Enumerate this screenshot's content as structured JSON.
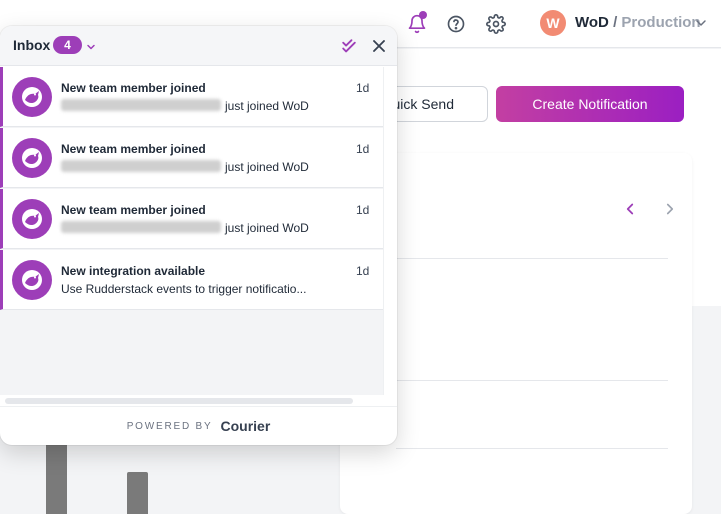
{
  "header": {
    "workspace": "WoD",
    "separator": "/",
    "environment": "Production",
    "avatar_initial": "W",
    "icons": [
      "bell-icon",
      "help-icon",
      "gear-icon",
      "chevron-down-icon"
    ]
  },
  "main": {
    "quick_send_label": "Quick Send",
    "quick_send_visible": "uick Send",
    "create_notification_label": "Create Notification"
  },
  "inbox": {
    "title": "Inbox",
    "count": "4",
    "items": [
      {
        "title": "New team member joined",
        "body": "just joined WoD",
        "body_redacted": true,
        "time": "1d"
      },
      {
        "title": "New team member joined",
        "body": "just joined WoD",
        "body_redacted": true,
        "time": "1d"
      },
      {
        "title": "New team member joined",
        "body": "just joined WoD",
        "body_redacted": true,
        "time": "1d"
      },
      {
        "title": "New integration available",
        "body": "Use Rudderstack events to trigger notificatio...",
        "body_redacted": false,
        "time": "1d"
      }
    ],
    "footer": {
      "powered_by": "POWERED BY",
      "brand": "Courier"
    }
  },
  "colors": {
    "accent": "#9d3eb8",
    "gradient_start": "#c33fa2",
    "gradient_end": "#9b1fc2",
    "avatar": "#f28b73"
  }
}
